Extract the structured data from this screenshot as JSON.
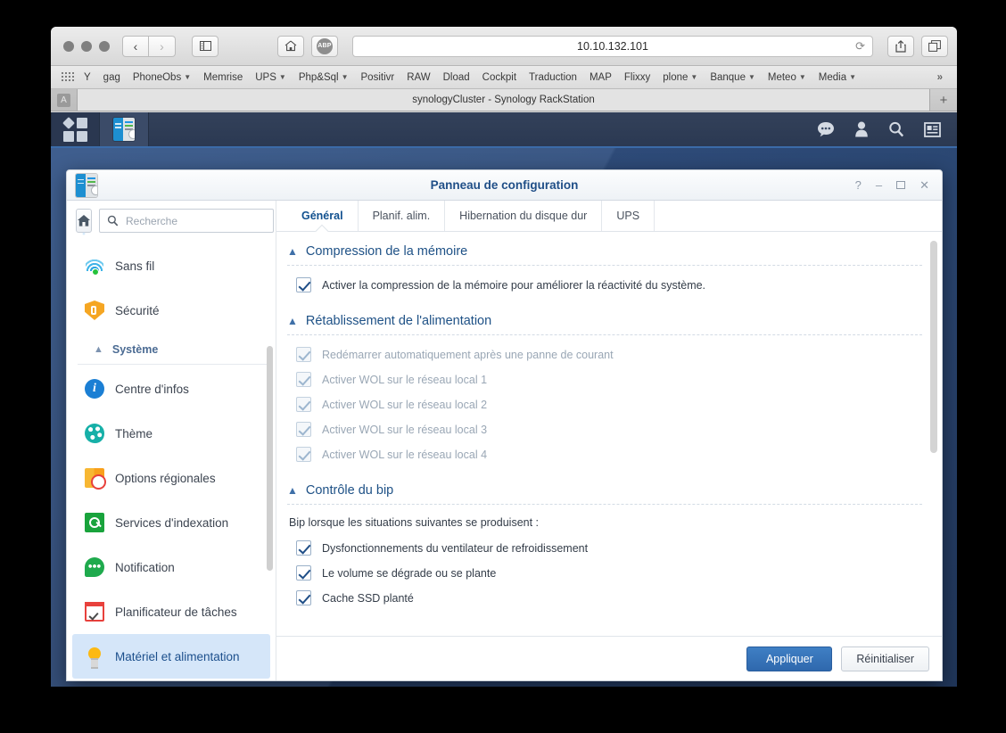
{
  "browser": {
    "url": "10.10.132.101",
    "back_icon": "chevron-left-icon",
    "forward_icon": "chevron-right-icon",
    "sidebar_icon": "sidebar-toggle-icon",
    "home_icon": "home-icon",
    "adblock_label": "ABP",
    "reload_icon": "reload-icon",
    "share_icon": "share-icon",
    "tabs_icon": "show-tabs-icon",
    "bookmarks": [
      {
        "label": "Y",
        "menu": false
      },
      {
        "label": "gag",
        "menu": false
      },
      {
        "label": "PhoneObs",
        "menu": true
      },
      {
        "label": "Memrise",
        "menu": false
      },
      {
        "label": "UPS",
        "menu": true
      },
      {
        "label": "Php&Sql",
        "menu": true
      },
      {
        "label": "Positivr",
        "menu": false
      },
      {
        "label": "RAW",
        "menu": false
      },
      {
        "label": "Dload",
        "menu": false
      },
      {
        "label": "Cockpit",
        "menu": false
      },
      {
        "label": "Traduction",
        "menu": false
      },
      {
        "label": "MAP",
        "menu": false
      },
      {
        "label": "Flixxy",
        "menu": false
      },
      {
        "label": "plone",
        "menu": true
      },
      {
        "label": "Banque",
        "menu": true
      },
      {
        "label": "Meteo",
        "menu": true
      },
      {
        "label": "Media",
        "menu": true
      }
    ],
    "bookmarks_overflow": "»",
    "tab_title": "synologyCluster - Synology RackStation",
    "favorites_tab_label": "A",
    "new_tab_label": "+"
  },
  "dsm_taskbar": {
    "main_menu_icon": "app-grid-icon",
    "open_app_icon": "control-panel-icon",
    "tray": [
      {
        "name": "notifications-icon"
      },
      {
        "name": "user-icon"
      },
      {
        "name": "search-icon"
      },
      {
        "name": "widgets-icon"
      }
    ]
  },
  "window": {
    "icon": "control-panel-icon",
    "title": "Panneau de configuration",
    "controls": [
      {
        "name": "help-button",
        "glyph": "?"
      },
      {
        "name": "minimize-button",
        "glyph": "–"
      },
      {
        "name": "maximize-button",
        "glyph": ""
      },
      {
        "name": "close-button",
        "glyph": "✕"
      }
    ]
  },
  "sidebar": {
    "home_icon": "home-icon",
    "search_placeholder": "Recherche",
    "search_value": "",
    "search_icon": "search-icon",
    "items": [
      {
        "type": "item",
        "label": "Sans fil",
        "icon": "wifi-icon",
        "icon_class": "i-wifi",
        "selected": false
      },
      {
        "type": "item",
        "label": "Sécurité",
        "icon": "shield-icon",
        "icon_class": "i-shield",
        "selected": false
      },
      {
        "type": "group",
        "label": "Système",
        "icon": "chevron-up-icon",
        "expanded": true
      },
      {
        "type": "item",
        "label": "Centre d'infos",
        "icon": "info-icon",
        "icon_class": "i-info",
        "selected": false
      },
      {
        "type": "item",
        "label": "Thème",
        "icon": "palette-icon",
        "icon_class": "i-theme",
        "selected": false
      },
      {
        "type": "item",
        "label": "Options régionales",
        "icon": "region-clock-icon",
        "icon_class": "i-region",
        "selected": false
      },
      {
        "type": "item",
        "label": "Services d'indexation",
        "icon": "index-search-icon",
        "icon_class": "i-index",
        "selected": false
      },
      {
        "type": "item",
        "label": "Notification",
        "icon": "speech-bubble-icon",
        "icon_class": "i-notif",
        "selected": false
      },
      {
        "type": "item",
        "label": "Planificateur de tâches",
        "icon": "calendar-check-icon",
        "icon_class": "i-sched",
        "selected": false
      },
      {
        "type": "item",
        "label": "Matériel et alimentation",
        "icon": "lightbulb-icon",
        "icon_class": "i-bulb",
        "selected": true
      }
    ]
  },
  "tabs": [
    {
      "label": "Général",
      "active": true
    },
    {
      "label": "Planif. alim.",
      "active": false
    },
    {
      "label": "Hibernation du disque dur",
      "active": false
    },
    {
      "label": "UPS",
      "active": false
    }
  ],
  "sections": [
    {
      "title": "Compression de la mémoire",
      "collapse_icon": "chevron-up-icon",
      "note": null,
      "checkboxes": [
        {
          "label": "Activer la compression de la mémoire pour améliorer la réactivité du système.",
          "checked": true,
          "disabled": false
        }
      ]
    },
    {
      "title": "Rétablissement de l'alimentation",
      "collapse_icon": "chevron-up-icon",
      "note": null,
      "checkboxes": [
        {
          "label": "Redémarrer automatiquement après une panne de courant",
          "checked": true,
          "disabled": true
        },
        {
          "label": "Activer WOL sur le réseau local 1",
          "checked": true,
          "disabled": true
        },
        {
          "label": "Activer WOL sur le réseau local 2",
          "checked": true,
          "disabled": true
        },
        {
          "label": "Activer WOL sur le réseau local 3",
          "checked": true,
          "disabled": true
        },
        {
          "label": "Activer WOL sur le réseau local 4",
          "checked": true,
          "disabled": true
        }
      ]
    },
    {
      "title": "Contrôle du bip",
      "collapse_icon": "chevron-up-icon",
      "note": "Bip lorsque les situations suivantes se produisent :",
      "checkboxes": [
        {
          "label": "Dysfonctionnements du ventilateur de refroidissement",
          "checked": true,
          "disabled": false
        },
        {
          "label": "Le volume se dégrade ou se plante",
          "checked": true,
          "disabled": false
        },
        {
          "label": "Cache SSD planté",
          "checked": true,
          "disabled": false
        }
      ]
    }
  ],
  "footer": {
    "apply_label": "Appliquer",
    "reset_label": "Réinitialiser"
  },
  "colors": {
    "accent": "#2f68ad",
    "title": "#1f4e87",
    "desktop": "#2e4c7a",
    "selected_row": "#d5e6f9"
  }
}
